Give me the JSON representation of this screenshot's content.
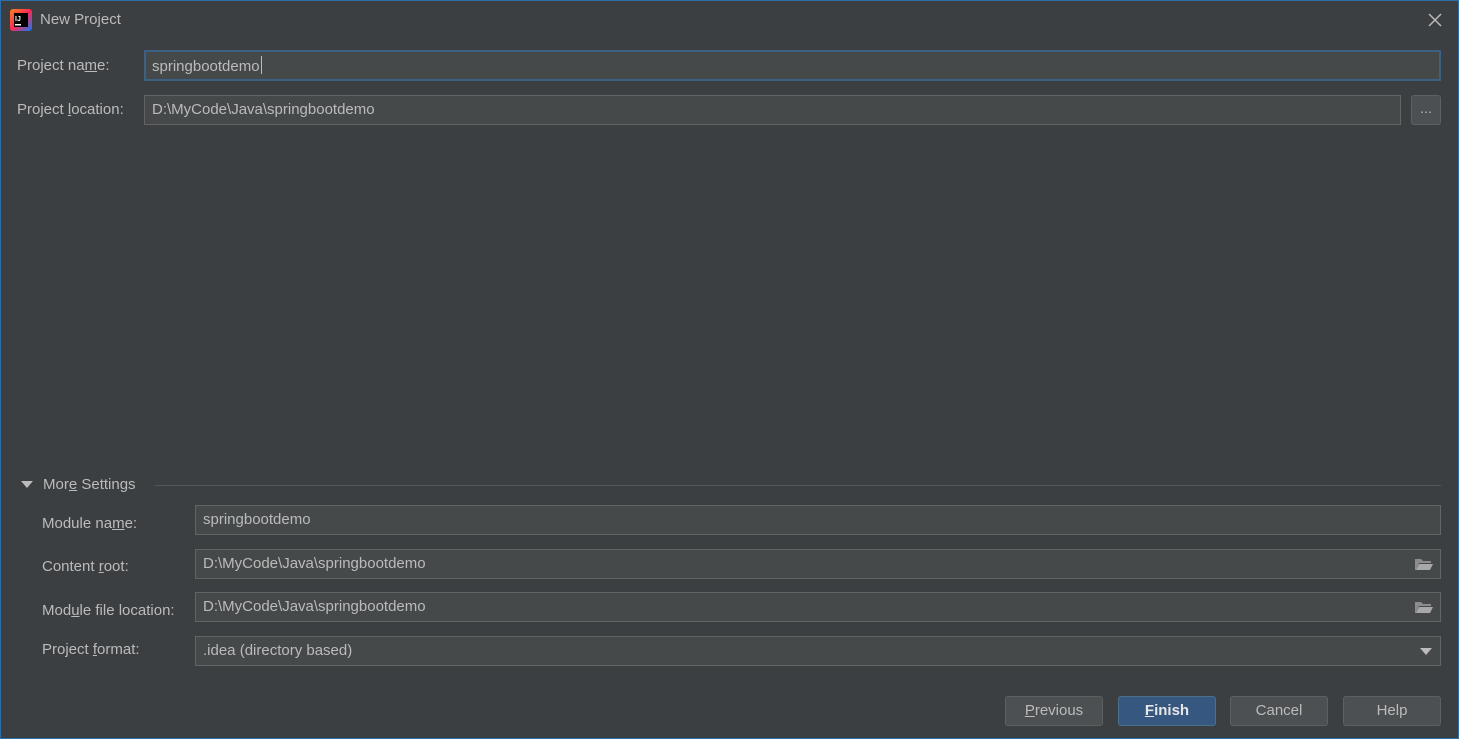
{
  "window": {
    "title": "New Project",
    "app_icon": "intellij-idea-icon"
  },
  "project": {
    "name_label_pre": "Project na",
    "name_label_u": "m",
    "name_label_post": "e:",
    "name_value": "springbootdemo",
    "location_label_pre": "Project ",
    "location_label_u": "l",
    "location_label_post": "ocation:",
    "location_value": "D:\\MyCode\\Java\\springbootdemo",
    "browse_label": "..."
  },
  "more_settings": {
    "header_pre": "Mor",
    "header_u": "e",
    "header_post": " Settings",
    "expanded": true,
    "module_name_label_pre": "Module na",
    "module_name_label_u": "m",
    "module_name_label_post": "e:",
    "module_name_value": "springbootdemo",
    "content_root_label_pre": "Content ",
    "content_root_label_u": "r",
    "content_root_label_post": "oot:",
    "content_root_value": "D:\\MyCode\\Java\\springbootdemo",
    "module_file_label_pre": "Mod",
    "module_file_label_u": "u",
    "module_file_label_post": "le file location:",
    "module_file_value": "D:\\MyCode\\Java\\springbootdemo",
    "format_label_pre": "Project ",
    "format_label_u": "f",
    "format_label_post": "ormat:",
    "format_value": ".idea (directory based)"
  },
  "buttons": {
    "previous_u": "P",
    "previous_rest": "revious",
    "finish_u": "F",
    "finish_rest": "inish",
    "cancel": "Cancel",
    "help": "Help"
  },
  "colors": {
    "background": "#3c3f41",
    "field_bg": "#45494a",
    "focus_border": "#3d6185",
    "primary_button": "#365880",
    "window_border": "#2d6ea8"
  }
}
